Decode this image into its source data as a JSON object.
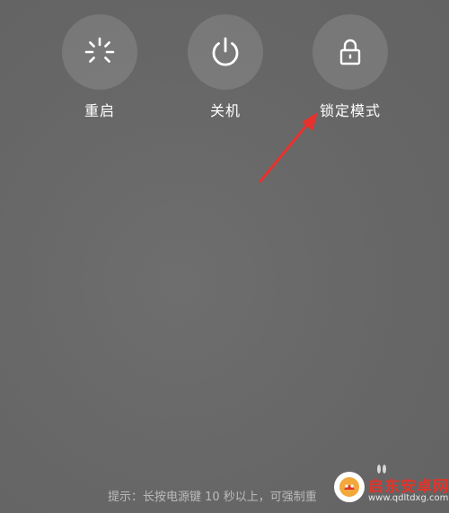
{
  "actions": {
    "restart": {
      "label": "重启",
      "icon": "restart-spinner-icon"
    },
    "power": {
      "label": "关机",
      "icon": "power-icon"
    },
    "lock": {
      "label": "锁定模式",
      "icon": "lock-icon"
    }
  },
  "hint": "提示：长按电源键 10 秒以上，可强制重",
  "annotation": {
    "icon": "red-arrow-icon",
    "color": "#e5322d"
  },
  "watermark": {
    "title": "启东安卓网",
    "url": "www.qdltdxg.com",
    "icon": "watermark-logo-icon",
    "color": "#e0352b"
  },
  "colors": {
    "background": "#6a6a6a",
    "button_circle": "rgba(255,255,255,0.13)",
    "text": "#ffffff"
  }
}
